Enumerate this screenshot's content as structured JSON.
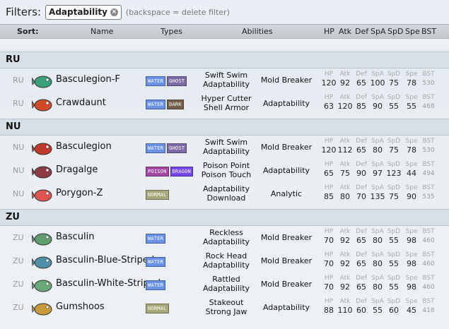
{
  "filters": {
    "label": "Filters:",
    "chip_label": "Adaptability",
    "hint": "(backspace = delete filter)"
  },
  "sortbar": {
    "sort": "Sort:",
    "name": "Name",
    "types": "Types",
    "abilities": "Abilities",
    "hp": "HP",
    "atk": "Atk",
    "def": "Def",
    "spa": "SpA",
    "spd": "SpD",
    "spe": "Spe",
    "bst": "BST"
  },
  "stat_labels": {
    "hp": "HP",
    "atk": "Atk",
    "def": "Def",
    "spa": "SpA",
    "spd": "SpD",
    "spe": "Spe",
    "bst": "BST"
  },
  "tiers": [
    {
      "label": "RU",
      "rows": [
        {
          "tier": "RU",
          "name": "Basculegion-F",
          "types": [
            "WATER",
            "GHOST"
          ],
          "ab1": "Swift Swim",
          "ab2": "Adaptability",
          "hidden": "Mold Breaker",
          "hp": "120",
          "atk": "92",
          "def": "65",
          "spa": "100",
          "spd": "75",
          "spe": "78",
          "bst": "530",
          "sprite": "#3aa07a"
        },
        {
          "tier": "RU",
          "name": "Crawdaunt",
          "types": [
            "WATER",
            "DARK"
          ],
          "ab1": "Hyper Cutter",
          "ab2": "Shell Armor",
          "hidden": "Adaptability",
          "hp": "63",
          "atk": "120",
          "def": "85",
          "spa": "90",
          "spd": "55",
          "spe": "55",
          "bst": "468",
          "sprite": "#d04a2a"
        }
      ]
    },
    {
      "label": "NU",
      "rows": [
        {
          "tier": "NU",
          "name": "Basculegion",
          "types": [
            "WATER",
            "GHOST"
          ],
          "ab1": "Swift Swim",
          "ab2": "Adaptability",
          "hidden": "Mold Breaker",
          "hp": "120",
          "atk": "112",
          "def": "65",
          "spa": "80",
          "spd": "75",
          "spe": "78",
          "bst": "530",
          "sprite": "#c0392b"
        },
        {
          "tier": "NU",
          "name": "Dragalge",
          "types": [
            "POISON",
            "DRAGON"
          ],
          "ab1": "Poison Point",
          "ab2": "Poison Touch",
          "hidden": "Adaptability",
          "hp": "65",
          "atk": "75",
          "def": "90",
          "spa": "97",
          "spd": "123",
          "spe": "44",
          "bst": "494",
          "sprite": "#8e3b46"
        },
        {
          "tier": "NU",
          "name": "Porygon-Z",
          "types": [
            "NORMAL"
          ],
          "ab1": "Adaptability",
          "ab2": "Download",
          "hidden": "Analytic",
          "hp": "85",
          "atk": "80",
          "def": "70",
          "spa": "135",
          "spd": "75",
          "spe": "90",
          "bst": "535",
          "sprite": "#e0544f"
        }
      ]
    },
    {
      "label": "ZU",
      "rows": [
        {
          "tier": "ZU",
          "name": "Basculin",
          "types": [
            "WATER"
          ],
          "ab1": "Reckless",
          "ab2": "Adaptability",
          "hidden": "Mold Breaker",
          "hp": "70",
          "atk": "92",
          "def": "65",
          "spa": "80",
          "spd": "55",
          "spe": "98",
          "bst": "460",
          "sprite": "#5f9e6e"
        },
        {
          "tier": "ZU",
          "name": "Basculin-Blue-Striped",
          "types": [
            "WATER"
          ],
          "ab1": "Rock Head",
          "ab2": "Adaptability",
          "hidden": "Mold Breaker",
          "hp": "70",
          "atk": "92",
          "def": "65",
          "spa": "80",
          "spd": "55",
          "spe": "98",
          "bst": "460",
          "sprite": "#4f8fa6"
        },
        {
          "tier": "ZU",
          "name": "Basculin-White-Striped",
          "types": [
            "WATER"
          ],
          "ab1": "Rattled",
          "ab2": "Adaptability",
          "hidden": "Mold Breaker",
          "hp": "70",
          "atk": "92",
          "def": "65",
          "spa": "80",
          "spd": "55",
          "spe": "98",
          "bst": "460",
          "sprite": "#6aa87a"
        },
        {
          "tier": "ZU",
          "name": "Gumshoos",
          "types": [
            "NORMAL"
          ],
          "ab1": "Stakeout",
          "ab2": "Strong Jaw",
          "hidden": "Adaptability",
          "hp": "88",
          "atk": "110",
          "def": "60",
          "spa": "55",
          "spd": "60",
          "spe": "45",
          "bst": "418",
          "sprite": "#c79a3a"
        }
      ]
    }
  ]
}
